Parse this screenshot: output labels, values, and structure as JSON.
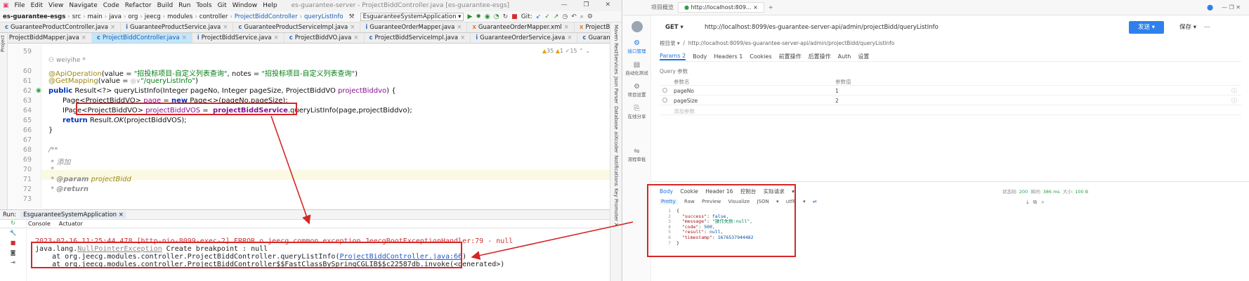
{
  "ide": {
    "menu": [
      "File",
      "Edit",
      "View",
      "Navigate",
      "Code",
      "Refactor",
      "Build",
      "Run",
      "Tools",
      "Git",
      "Window",
      "Help"
    ],
    "window_title": "es-guarantee-server - ProjectBiddController.java [es-guarantee-esgs]",
    "breadcrumb": [
      "es-guarantee-esgs",
      "src",
      "main",
      "java",
      "org",
      "jeecg",
      "modules",
      "controller",
      "ProjectBiddController",
      "queryListInfo"
    ],
    "run_config": "EsguaranteeSystemApplication",
    "git_label": "Git:",
    "tabs_row1": [
      "GuaranteeProductController.java",
      "GuaranteeProductService.java",
      "GuaranteeProductServiceImpl.java",
      "GuaranteeOrderMapper.java",
      "GuaranteeOrderMapper.xml",
      "ProjectBiddingMapper.xml"
    ],
    "tabs_row2": [
      "ProjectBiddMapper.java",
      "ProjectBiddController.java",
      "ProjectBiddService.java",
      "ProjectBiddVO.java",
      "ProjectBiddServiceImpl.java",
      "GuaranteeOrderService.java",
      "GuaranteeOrderServiceImpl.java"
    ],
    "inspections": {
      "warnings": "35",
      "weak": "1",
      "typos": "15"
    },
    "left_tools": [
      "Project",
      "Bookmarks"
    ],
    "right_tools": [
      "Maven",
      "RestServices",
      "Json Parser",
      "Database",
      "aiXcoder",
      "Notifications",
      "Key Promoter X"
    ],
    "author_hint": "weiyihe *",
    "code": {
      "l59": "59",
      "l60": "60",
      "l61": "61",
      "l62": "62",
      "l63": "63",
      "l64": "64",
      "l65": "65",
      "l66": "66",
      "l67": "67",
      "l68": "68",
      "l69": "69",
      "l70": "70",
      "l71": "71",
      "l72": "72",
      "l73": "73",
      "ann1": "@ApiOperation",
      "ann1_args": "(value = ",
      "str1": "\"招投标项目-自定义列表查询\"",
      "ann1_mid": ", notes = ",
      "str2": "\"招投标项目-自定义列表查询\"",
      "ann1_end": ")",
      "ann2": "@GetMapping",
      "ann2_args": "(value = ",
      "inlay": "◎∨",
      "str3": "\"/queryListInfo\"",
      "ann2_end": ")",
      "kw_public": "public",
      "sig": " Result<?> queryListInfo(Integer pageNo, Integer pageSize, ProjectBiddVO ",
      "param": "projectBiddvo",
      "sig_end": ") {",
      "l63_a": "Page<ProjectBiddVO> ",
      "l63_var": "page",
      "l63_b": " = ",
      "kw_new": "new",
      "l63_c": " Page<>(pageNo,pageSize);",
      "l64_a": "IPage<ProjectBiddVO> ",
      "l64_var": "projectBiddVOS",
      "l64_b": " =  ",
      "l64_field": "projectBiddService",
      "l64_c": ".queryListInfo(page,projectBiddvo);",
      "kw_return": "return",
      "l65_a": " Result.",
      "l65_ok": "OK",
      "l65_b": "(projectBiddVOS);",
      "brace": "}",
      "doc1": "/**",
      "doc2": " * 添加",
      "doc3": " *",
      "doc4_tag": "@param",
      "doc4_val": " projectBidd",
      "doc5_tag": "@return"
    },
    "run": {
      "label": "Run:",
      "config": "EsguaranteeSystemApplication",
      "tabs": [
        "Console",
        "Actuator"
      ],
      "log_error": "2023-02-16 11:25:44.478 [http-nio-8099-exec-2] ERROR o.jeecg.common.exception.JeecgBootExceptionHandler:79 - null",
      "npe_prefix": "java.lang.",
      "npe_name": "NullPointerException",
      "npe_suffix": " Create breakpoint : null",
      "trace1_prefix": "    at org.jeecg.modules.controller.ProjectBiddController.queryListInfo(",
      "trace1_link": "ProjectBiddController.java:66",
      "trace1_suffix": ")",
      "trace2": "    at org.jeecg.modules.controller.ProjectBiddController$$FastClassBySpringCGLIB$$c22587db.invoke(<generated>)"
    }
  },
  "api": {
    "browser_tabs": [
      "项目概览",
      "http://localhost:809..."
    ],
    "plus": "+",
    "sidebar": [
      "接口管理",
      "自动化测试",
      "项目设置",
      "在线分享",
      "流程审批"
    ],
    "method": "GET",
    "url": "http://localhost:8099/es-guarantee-server-api/admin/projectBidd/queryListInfo",
    "send": "发送",
    "save": "保存",
    "root_label": "根目录",
    "root_url": "http://localhost:8099/es-guarantee-server-api/admin/projectBidd/queryListInfo",
    "req_tabs": [
      "Params 2",
      "Body",
      "Headers 1",
      "Cookies",
      "前置操作",
      "后置操作",
      "Auth",
      "设置"
    ],
    "query_label": "Query 参数",
    "param_head": [
      "参数名",
      "参数值"
    ],
    "params": [
      {
        "k": "pageNo",
        "v": "1"
      },
      {
        "k": "pageSize",
        "v": "2"
      }
    ],
    "add_param": "添加参数",
    "resp_tabs": [
      "Body",
      "Cookie",
      "Header 16",
      "控制台",
      "实际请求"
    ],
    "resp_status_label": "状态码:",
    "resp_status": "200",
    "resp_time_label": "耗时:",
    "resp_time": "386 ms",
    "resp_size_label": "大小:",
    "resp_size": "100 B",
    "fmt": [
      "Pretty",
      "Raw",
      "Preview",
      "Visualize",
      "JSON",
      "utf8"
    ],
    "json": {
      "g1": "1",
      "g2": "2",
      "g3": "3",
      "g4": "4",
      "g5": "5",
      "g6": "6",
      "g7": "7",
      "open": "{",
      "close": "}",
      "k1": "\"success\"",
      "v1": "false,",
      "k2": "\"message\"",
      "v2": "\"操作失败:null\",",
      "k3": "\"code\"",
      "v3": "500,",
      "k4": "\"result\"",
      "v4": "null,",
      "k5": "\"timestamp\"",
      "v5": "1676537944482"
    }
  },
  "colors": {
    "annotation_red": "#d62626",
    "accent_blue": "#2f80ed",
    "active_tab": "#c2e6fa"
  }
}
